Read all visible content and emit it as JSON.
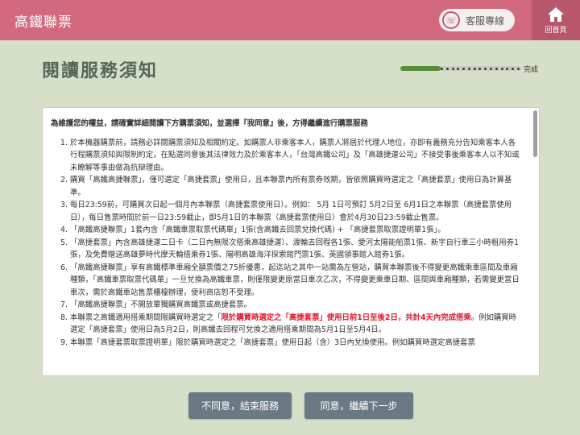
{
  "header": {
    "title": "高鐵聯票",
    "service_label": "客服專線",
    "home_label": "回首頁"
  },
  "page": {
    "title": "閱讀服務須知"
  },
  "progress": {
    "label": "完成",
    "fraction": 0.33
  },
  "notice": {
    "intro": "為維護您的權益，請確實詳細閱讀下方購票須知，並選擇『我同意』後，方得繼續進行購票服務",
    "items": [
      {
        "num": "1.",
        "text": "於本機器購票前，請務必詳閱購票須知及相關約定。如購票人非乘客本人，購票人將居於代理人地位，亦即有義務充分告知乘客本人各行程購票須知與限制約定，在點選同意後其法律效力及於乘客本人，「台灣高鐵公司」及「高雄捷運公司」不接受事後乘客本人以不知或未瞭解等事由做為抗辯理由。"
      },
      {
        "num": "2.",
        "text": "購買「高鐵高捷聯票」，僅可選定「高捷套票」使用日，且本聯票內所有票券效期，皆依照購買時選定之「高捷套票」使用日為計算基準。"
      },
      {
        "num": "3.",
        "text": "每日23:59前，可購買次日起一個月內本聯票（高捷套票使用日）。例如： 5月 1日可預訂 5月2日至 6月1日之本聯票（高捷套票使用日），每日售票時間於前一日23:59截止，即5月1日的本聯票（高捷套票使用日）會於4月30日23:59截止售票。"
      },
      {
        "num": "4.",
        "text": "「高鐵高捷聯票」1套內含「高鐵車票取票代碼單」1張(含高鐵去回票兌換代碼) + 「高捷套票取票證明單1張」。"
      },
      {
        "num": "5.",
        "text": "「高捷套票」內含高雄捷運二日卡（二日內無限次搭乘高雄捷運）、渡輪去回程各1張、愛河太陽能船票1張、新宇自行車三小時租用券1張，及免費贈送高雄夢時代摩天輪搭乘券1張、陽明高雄海洋探索館門票1張、英國領事館入館券1張。"
      },
      {
        "num": "6.",
        "text": "「高鐵高捷聯票」享有高鐵標準車廂全額票價之75折優惠，起迄站之其中一站需為左營站，購買本聯票後不得變更高鐵乘車區間及車廂種類，「高鐵車票取票代碼單」一旦兌換為高鐵車票，則僅限變更原當日車次乙次，不得變更乘車日期、區間與車廂種類，若需變更當日車次，需於高鐵車站售票櫃檯辦理，便利商店恕不受理。"
      },
      {
        "num": "7.",
        "text": "「高鐵高捷聯票」不開放單獨購買高鐵票或高捷套票。"
      },
      {
        "num": "8.",
        "text_before": "本聯票之高鐵適用搭乘期間限購買時選定之「",
        "text_red": "限於購買時選定之「高捷套票」使用日前1日至後2日，共計4天內完成搭乘",
        "text_after": "。例如購買時選定「高捷套票」使用日為5月2日，則高鐵去回程可兌換之適用搭乘期間為5月1日至5月4日。"
      },
      {
        "num": "9.",
        "text": "本聯票「高捷套票取票證明單」限於購買時選定之「高捷套票」使用日起（含）3日內兌換使用。例如購買時選定高捷套票"
      }
    ]
  },
  "buttons": {
    "cancel_label": "不同意，結束服務",
    "agree_label": "同意，繼續下一步"
  },
  "colors": {
    "header_bg": "#d2697f",
    "home_bg": "#b8566b",
    "page_bg": "#d6dfc8",
    "progress_fill": "#5a8e3c",
    "highlight_red": "#e0192c",
    "button_bg": "#6a7a84"
  }
}
